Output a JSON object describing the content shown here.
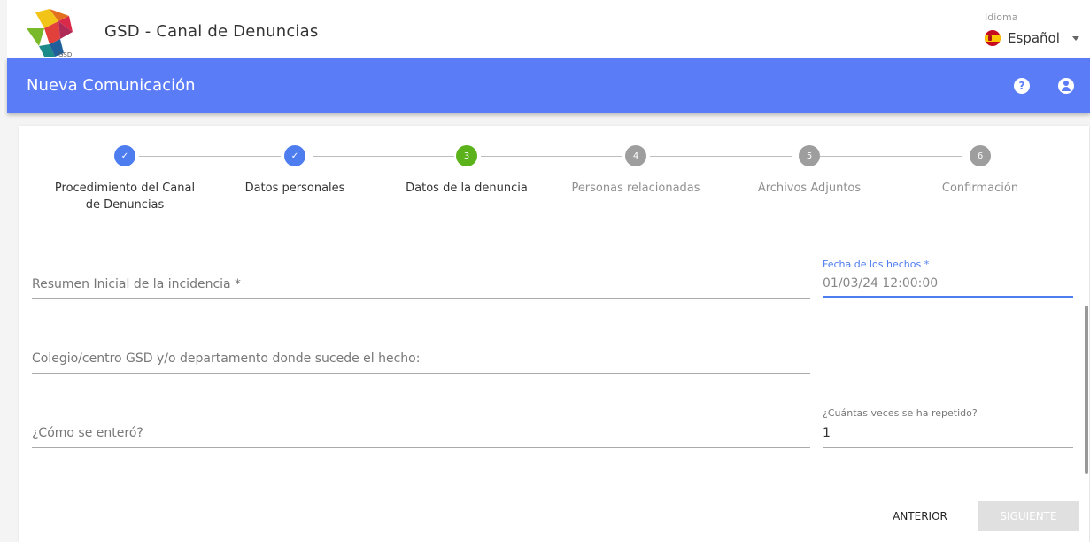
{
  "header": {
    "app_title": "GSD - Canal de Denuncias",
    "logo_text": "GSD",
    "language_label": "Idioma",
    "language_value": "Español"
  },
  "appbar": {
    "title": "Nueva Comunicación",
    "help_glyph": "?"
  },
  "stepper": {
    "steps": [
      {
        "label_line1": "Procedimiento del Canal",
        "label_line2": "de Denuncias",
        "state": "done",
        "number": "✓"
      },
      {
        "label_line1": "Datos personales",
        "label_line2": "",
        "state": "done",
        "number": "✓"
      },
      {
        "label_line1": "Datos de la denuncia",
        "label_line2": "",
        "state": "active",
        "number": "3"
      },
      {
        "label_line1": "Personas relacionadas",
        "label_line2": "",
        "state": "todo",
        "number": "4"
      },
      {
        "label_line1": "Archivos Adjuntos",
        "label_line2": "",
        "state": "todo",
        "number": "5"
      },
      {
        "label_line1": "Confirmación",
        "label_line2": "",
        "state": "todo",
        "number": "6"
      }
    ]
  },
  "form": {
    "resumen_placeholder": "Resumen Inicial de la incidencia *",
    "fecha_label": "Fecha de los hechos *",
    "fecha_value": "01/03/24 12:00:00",
    "colegio_placeholder": "Colegio/centro GSD y/o departamento donde sucede el hecho:",
    "como_placeholder": "¿Cómo se enteró?",
    "veces_label": "¿Cuántas veces se ha repetido?",
    "veces_value": "1"
  },
  "actions": {
    "prev_label": "ANTERIOR",
    "next_label": "SIGUIENTE"
  },
  "colors": {
    "appbar": "#5b7cf7",
    "step_done": "#4e7df0",
    "step_active": "#5cb21a",
    "step_todo": "#9e9e9e"
  }
}
